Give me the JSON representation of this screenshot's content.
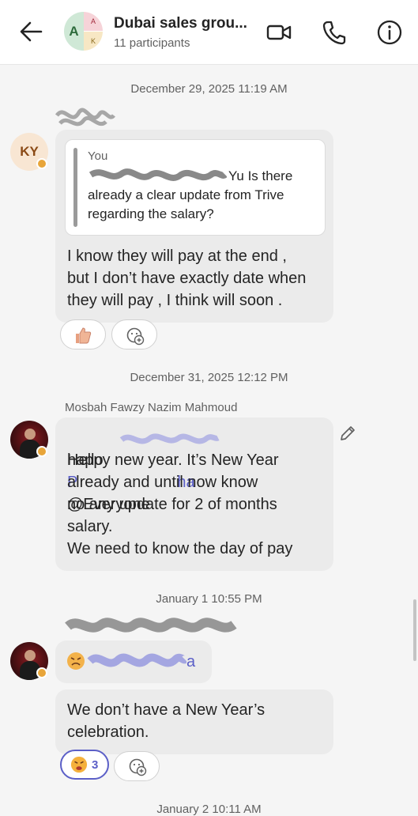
{
  "header": {
    "back_icon": "arrow-left-icon",
    "group_avatar": {
      "big": "A",
      "tr": "A",
      "br": "K"
    },
    "title": "Dubai sales grou...",
    "participants": "11 participants",
    "video_icon": "video-call-icon",
    "phone_icon": "phone-call-icon",
    "info_icon": "info-icon"
  },
  "chat": {
    "divider1": "December 29, 2025 11:19 AM",
    "msg1": {
      "avatar_initials": "KY",
      "quote_author": "You",
      "quote_line1": "Yu Is there",
      "quote_rest": "already a clear update from Trive regarding the salary?",
      "text": "I know they will pay at the end ,\nbut I don’t have exactly date when\nthey will pay , I think will soon .",
      "reaction": "thumbs-up-emoji",
      "add_reaction_icon": "add-reaction-icon"
    },
    "divider2": "December 31, 2025 12:12 PM",
    "msg2": {
      "sender": "Mosbah Fawzy Nazim Mahmoud",
      "hello": "Hello",
      "mention_start": "P",
      "mention_end": "ha",
      "everyone": "@Everyone",
      "text": "happy new year. It’s New Year\nalready and until now know\nno any update for 2 of months\nsalary.\n We need to know the day of pay",
      "edit_icon": "pencil-edit-icon"
    },
    "divider3": "January 1 10:55 PM",
    "msg3": {
      "mention_end": "a",
      "text": "We don’t have a New Year’s\ncelebration.",
      "reaction_count": "3",
      "reaction": "sad-face-emoji",
      "add_reaction_icon": "add-reaction-icon"
    },
    "divider4": "January 2 10:11 AM"
  },
  "colors": {
    "accent": "#5b5fc7",
    "bubble": "#ebebeb",
    "status": "#e8a53a"
  }
}
